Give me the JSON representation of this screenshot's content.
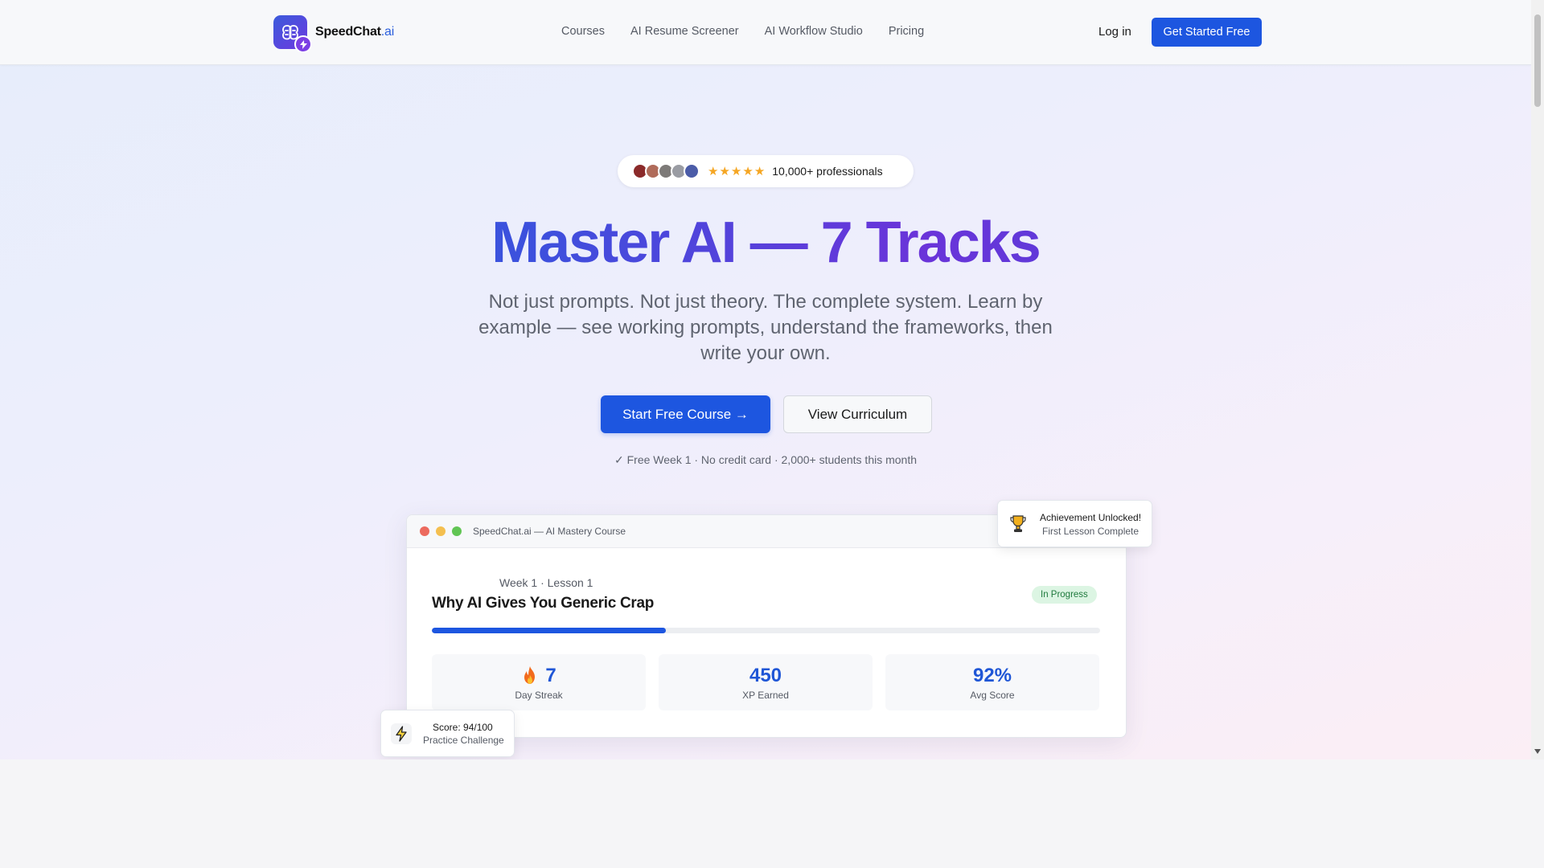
{
  "nav": {
    "logo_name": "SpeedChat",
    "logo_suffix": ".ai",
    "links": [
      "Courses",
      "AI Resume Screener",
      "AI Workflow Studio",
      "Pricing"
    ],
    "login": "Log in",
    "cta": "Get Started Free"
  },
  "social_proof": {
    "rating_stars": 5,
    "text": "10,000+ professionals",
    "avatar_colors": [
      "#8b2a2a",
      "#b06b5a",
      "#7d7a78",
      "#9a9ca3",
      "#4b5ca8"
    ]
  },
  "hero": {
    "title": "Master AI — 7 Tracks",
    "subtitle": "Not just prompts. Not just theory. The complete system. Learn by example — see working prompts, understand the frameworks, then write your own.",
    "primary_button": "Start Free Course →",
    "secondary_button": "View Curriculum",
    "fine_print": "✓ Free Week 1 · No credit card · 2,000+ students this month"
  },
  "mock_window": {
    "title": "SpeedChat.ai — AI Mastery Course",
    "lesson_meta": "Week 1 · Lesson 1",
    "lesson_title": "Why AI Gives You Generic Crap",
    "status": "In Progress",
    "progress": 0.35,
    "stats": [
      {
        "value": "7",
        "label": "Day Streak",
        "icon": "flame-icon"
      },
      {
        "value": "450",
        "label": "XP Earned"
      },
      {
        "value": "92%",
        "label": "Avg Score"
      }
    ]
  },
  "achievement": {
    "title": "Achievement Unlocked!",
    "subtitle": "First Lesson Complete",
    "icon": "trophy-icon"
  },
  "score_card": {
    "title": "Score: 94/100",
    "subtitle": "Practice Challenge",
    "icon": "lightning-icon"
  },
  "colors": {
    "brand": "#1d56e0",
    "accent_purple": "#6a34d9",
    "badge_green_bg": "#dcf5e3",
    "badge_green_text": "#1f7a3d",
    "star": "#f5a623"
  }
}
